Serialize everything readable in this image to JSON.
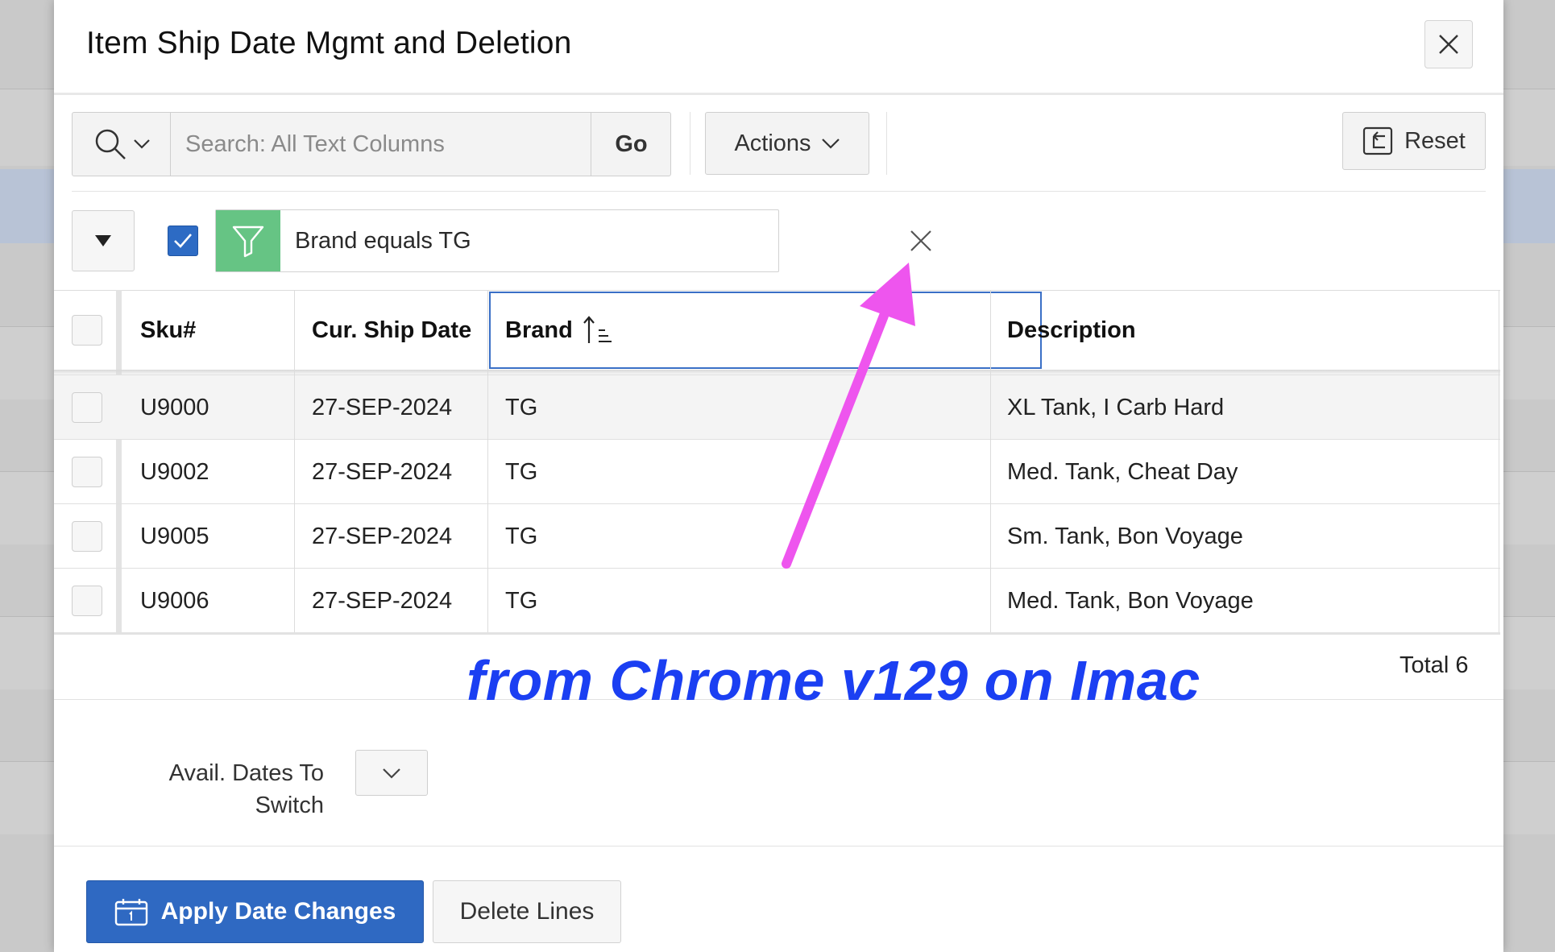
{
  "dialog": {
    "title": "Item Ship Date Mgmt and Deletion",
    "close_label": "×"
  },
  "toolbar": {
    "search_placeholder": "Search: All Text Columns",
    "go_label": "Go",
    "actions_label": "Actions",
    "reset_label": "Reset"
  },
  "filter": {
    "enabled": true,
    "text": "Brand equals TG",
    "chip_color": "#66c484"
  },
  "grid": {
    "columns": [
      "Sku#",
      "Cur. Ship Date",
      "Brand",
      "Description"
    ],
    "sorted_column": "Brand",
    "sort_direction": "ascending",
    "rows": [
      {
        "sku": "U9000",
        "date": "27-SEP-2024",
        "brand": "TG",
        "desc": "XL Tank, I Carb Hard"
      },
      {
        "sku": "U9002",
        "date": "27-SEP-2024",
        "brand": "TG",
        "desc": "Med. Tank, Cheat Day"
      },
      {
        "sku": "U9005",
        "date": "27-SEP-2024",
        "brand": "TG",
        "desc": "Sm. Tank, Bon Voyage"
      },
      {
        "sku": "U9006",
        "date": "27-SEP-2024",
        "brand": "TG",
        "desc": "Med. Tank, Bon Voyage"
      }
    ],
    "total_label": "Total 6"
  },
  "form": {
    "avail_dates_label_line1": "Avail. Dates To",
    "avail_dates_label_line2": "Switch"
  },
  "buttons": {
    "apply_label": "Apply Date Changes",
    "delete_label": "Delete Lines"
  },
  "annotation": {
    "text": "from Chrome v129 on Imac",
    "text_color": "#1b3ff2",
    "arrow_color": "#ee55ee"
  },
  "colors": {
    "primary": "#2f69c2",
    "selection_outline": "#3a6fc6"
  }
}
